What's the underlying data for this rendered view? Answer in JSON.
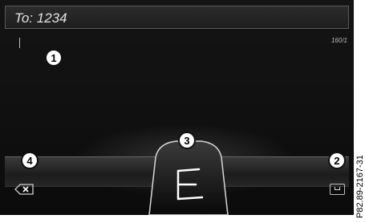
{
  "recipient": {
    "label": "To:",
    "value": "1234"
  },
  "editor": {
    "char_count": "160/1"
  },
  "handwriting": {
    "recognized_letter": "E"
  },
  "callouts": [
    "1",
    "2",
    "3",
    "4"
  ],
  "figure_id": "P82.89-2167-31",
  "icons": {
    "backspace": "backspace-icon",
    "space": "space-icon"
  },
  "colors": {
    "screen_bg": "#111111",
    "callout_bg": "#ffffff"
  }
}
